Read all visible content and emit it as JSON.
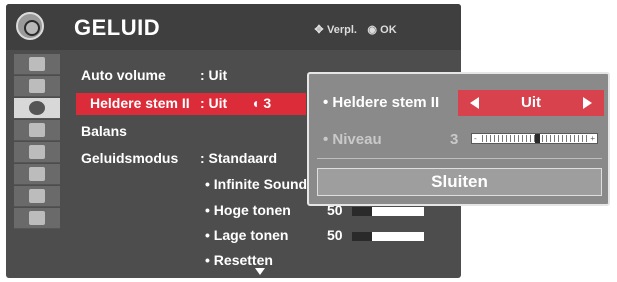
{
  "header": {
    "title": "GELUID",
    "hint_move": "Verpl.",
    "hint_ok": "OK",
    "move_icon": "four-way-arrows-icon",
    "ok_icon": "ok-button-icon"
  },
  "sidebar": {
    "items": [
      {
        "icon": "satellite-icon"
      },
      {
        "icon": "picture-icon"
      },
      {
        "icon": "audio-icon",
        "active": true
      },
      {
        "icon": "clock-icon"
      },
      {
        "icon": "lock-icon"
      },
      {
        "icon": "option-icon"
      },
      {
        "icon": "input-icon"
      },
      {
        "icon": "media-icon"
      }
    ]
  },
  "menu": {
    "auto_volume_label": "Auto volume",
    "auto_volume_value": ": Uit",
    "clear_voice_label": "Heldere stem II",
    "clear_voice_value": ": Uit",
    "clear_voice_level": "3",
    "balance_label": "Balans",
    "sound_mode_label": "Geluidsmodus",
    "sound_mode_value": ": Standaard",
    "infinite_sound_label": "• Infinite Sound",
    "treble_label": "• Hoge tonen",
    "treble_value": "50",
    "bass_label": "• Lage tonen",
    "bass_value": "50",
    "reset_label": "• Resetten"
  },
  "popup": {
    "clear_voice_label": "• Heldere stem II",
    "clear_voice_value": "Uit",
    "level_label": "• Niveau",
    "level_value": "3",
    "level_fraction": 0.5,
    "scale_minus": "-",
    "scale_plus": "+",
    "close_label": "Sluiten"
  },
  "colors": {
    "panel_bg": "#4d4d4d",
    "highlight": "#dd2c39",
    "selector": "#d7424d",
    "popup_bg": "#8a8a8a"
  }
}
